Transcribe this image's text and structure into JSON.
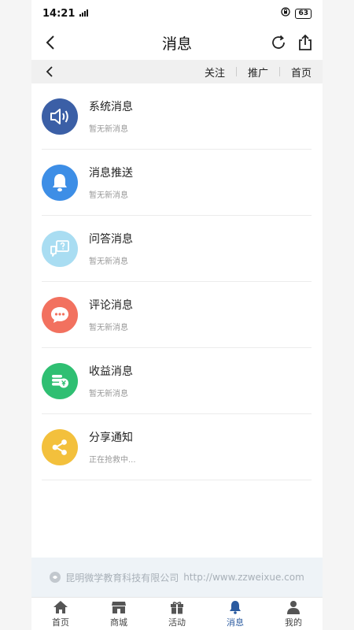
{
  "status": {
    "time": "14:21",
    "battery": "63"
  },
  "header": {
    "title": "消息"
  },
  "subnav": {
    "links": [
      "关注",
      "推广",
      "首页"
    ]
  },
  "messages": [
    {
      "title": "系统消息",
      "subtitle": "暂无新消息",
      "icon": "speaker-icon",
      "color": "#3b5fa6"
    },
    {
      "title": "消息推送",
      "subtitle": "暂无新消息",
      "icon": "bell-icon",
      "color": "#3d8ee6"
    },
    {
      "title": "问答消息",
      "subtitle": "暂无新消息",
      "icon": "question-icon",
      "color": "#a9ddf2"
    },
    {
      "title": "评论消息",
      "subtitle": "暂无新消息",
      "icon": "comment-icon",
      "color": "#f2715f"
    },
    {
      "title": "收益消息",
      "subtitle": "暂无新消息",
      "icon": "coins-icon",
      "color": "#2fbf72"
    },
    {
      "title": "分享通知",
      "subtitle": "正在抢救中...",
      "icon": "share-icon",
      "color": "#f3c03c"
    }
  ],
  "footer": {
    "company": "昆明微学教育科技有限公司",
    "url": "http://www.zzweixue.com"
  },
  "tabs": [
    {
      "label": "首页",
      "icon": "home-icon"
    },
    {
      "label": "商城",
      "icon": "store-icon"
    },
    {
      "label": "活动",
      "icon": "gift-icon"
    },
    {
      "label": "消息",
      "icon": "bell-icon"
    },
    {
      "label": "我的",
      "icon": "user-icon"
    }
  ],
  "tabs_active": "消息",
  "colors": {
    "accent": "#2b5ba0",
    "divider": "#ececec",
    "subnav_bg": "#f0f0f0"
  }
}
